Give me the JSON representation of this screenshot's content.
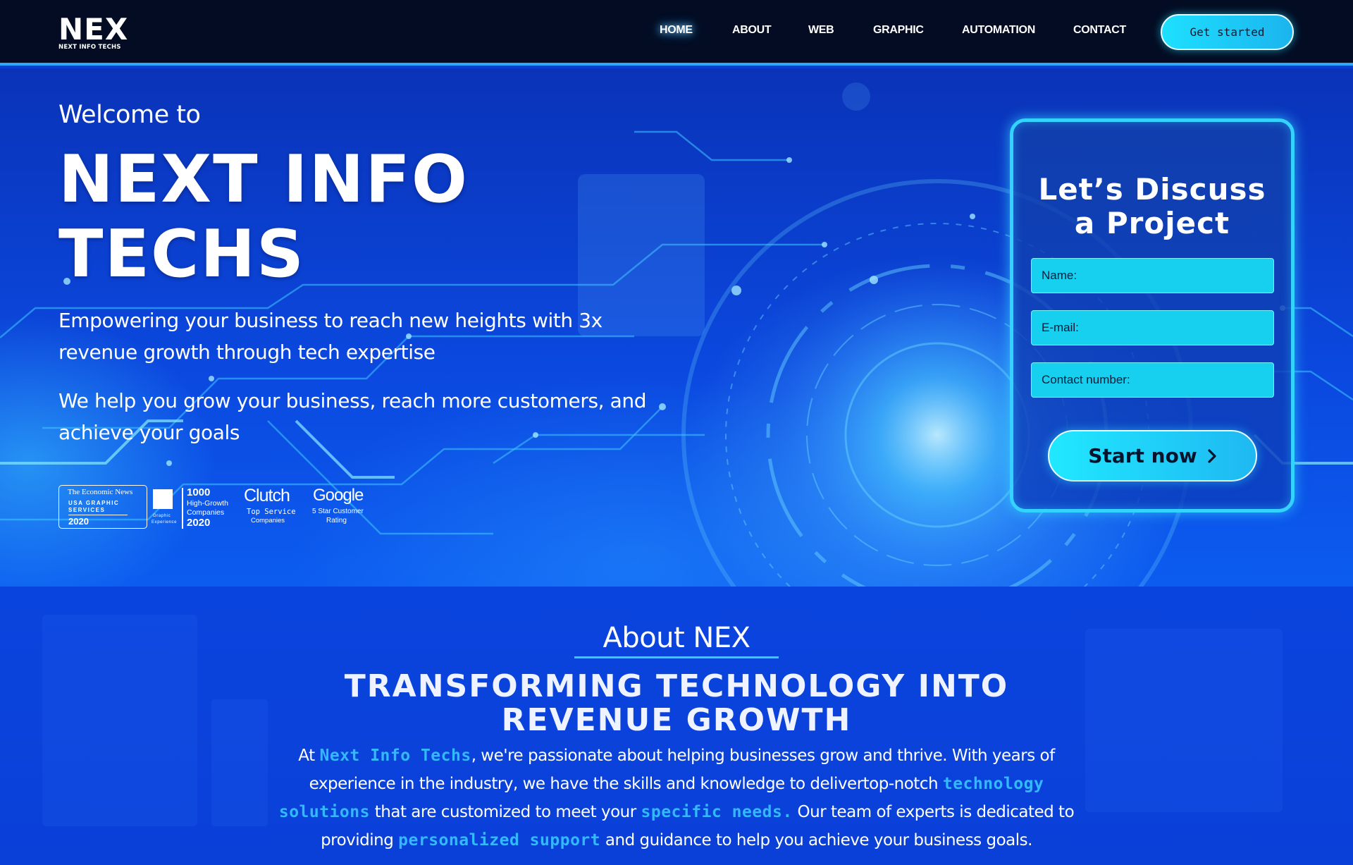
{
  "header": {
    "logo_main": "NEX",
    "logo_sub": "NEXT INFO TECHS",
    "nav": [
      {
        "label": "HOME",
        "active": true
      },
      {
        "label": "ABOUT",
        "active": false
      },
      {
        "label": "WEB",
        "active": false
      },
      {
        "label": "GRAPHIC",
        "active": false
      },
      {
        "label": "AUTOMATION",
        "active": false
      },
      {
        "label": "CONTACT",
        "active": false
      }
    ],
    "cta_label": "Get started"
  },
  "hero": {
    "welcome": "Welcome to",
    "title_line1": "NEXT INFO",
    "title_line2": "TECHS",
    "subtitle1": "Empowering your business to reach new heights with 3x revenue growth through tech expertise",
    "subtitle2": "We help you grow your business, reach more customers, and achieve your goals",
    "badges": {
      "economic_title": "The Economic News",
      "economic_line1": "USA GRAPHIC",
      "economic_line2": "SERVICES",
      "economic_year": "2020",
      "graphic_caption1": "Graphic",
      "graphic_caption2": "Experience",
      "growth_number": "1000",
      "growth_line1": "High-Growth",
      "growth_line2": "Companies",
      "growth_year": "2020",
      "clutch_name": "Clutch",
      "clutch_line1": "Top Service",
      "clutch_line2": "Companies",
      "google_name": "Google",
      "google_line1": "5 Star Customer",
      "google_line2": "Rating"
    }
  },
  "form": {
    "title_line1": "Let’s Discuss",
    "title_line2": "a Project",
    "name_placeholder": "Name:",
    "email_placeholder": "E-mail:",
    "phone_placeholder": "Contact number:",
    "submit_label": "Start now"
  },
  "about": {
    "kicker": "About NEX",
    "title_line1": "TRANSFORMING TECHNOLOGY INTO",
    "title_line2": "REVENUE GROWTH",
    "body": {
      "t1": "At ",
      "h1": "Next Info Techs",
      "t2": ", we're passionate about helping businesses grow and thrive. With years of experience in the industry, we have the skills and knowledge to delivertop-notch ",
      "h2": "technology solutions",
      "t3": " that are customized to meet your ",
      "h3": "specific needs.",
      "t4": " Our team of experts is dedicated to providing ",
      "h4": "personalized support",
      "t5": " and guidance to help you achieve your business goals."
    }
  },
  "colors": {
    "header_bg": "#030c22",
    "accent_cyan": "#1ee0ff",
    "hero_blue": "#0b49e0",
    "highlight": "#32b9ff"
  }
}
